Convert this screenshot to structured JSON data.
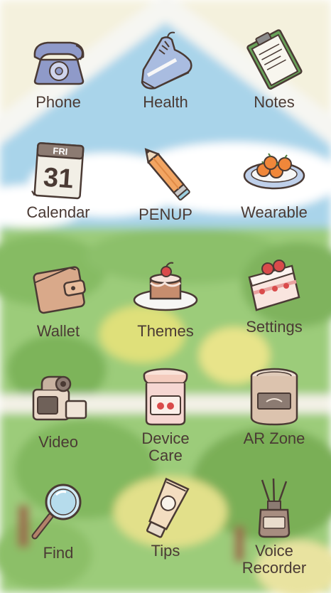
{
  "screen": {
    "apps": [
      {
        "label": "Phone",
        "icon": "phone-icon"
      },
      {
        "label": "Health",
        "icon": "sneaker-icon"
      },
      {
        "label": "Notes",
        "icon": "notepad-icon"
      },
      {
        "label": "Calendar",
        "icon": "calendar-icon",
        "icon_day": "FRI",
        "icon_date": "31"
      },
      {
        "label": "PENUP",
        "icon": "pencil-icon"
      },
      {
        "label": "Wearable",
        "icon": "fruit-plate-icon"
      },
      {
        "label": "Wallet",
        "icon": "wallet-icon"
      },
      {
        "label": "Themes",
        "icon": "cake-icon"
      },
      {
        "label": "Settings",
        "icon": "cake-slice-icon"
      },
      {
        "label": "Video",
        "icon": "video-camera-icon"
      },
      {
        "label": "Device Care",
        "label_line1": "Device",
        "label_line2": "Care",
        "icon": "jam-jar-icon"
      },
      {
        "label": "AR Zone",
        "icon": "candle-jar-icon"
      },
      {
        "label": "Find",
        "icon": "magnifier-icon"
      },
      {
        "label": "Tips",
        "icon": "lotion-tube-icon"
      },
      {
        "label": "Voice Recorder",
        "label_line1": "Voice",
        "label_line2": "Recorder",
        "icon": "reed-diffuser-icon"
      }
    ]
  },
  "colors": {
    "sky": "#a9d4ea",
    "grass": "#9ccc7a",
    "outline": "#4a3a34",
    "label_text": "#4a3a34"
  }
}
